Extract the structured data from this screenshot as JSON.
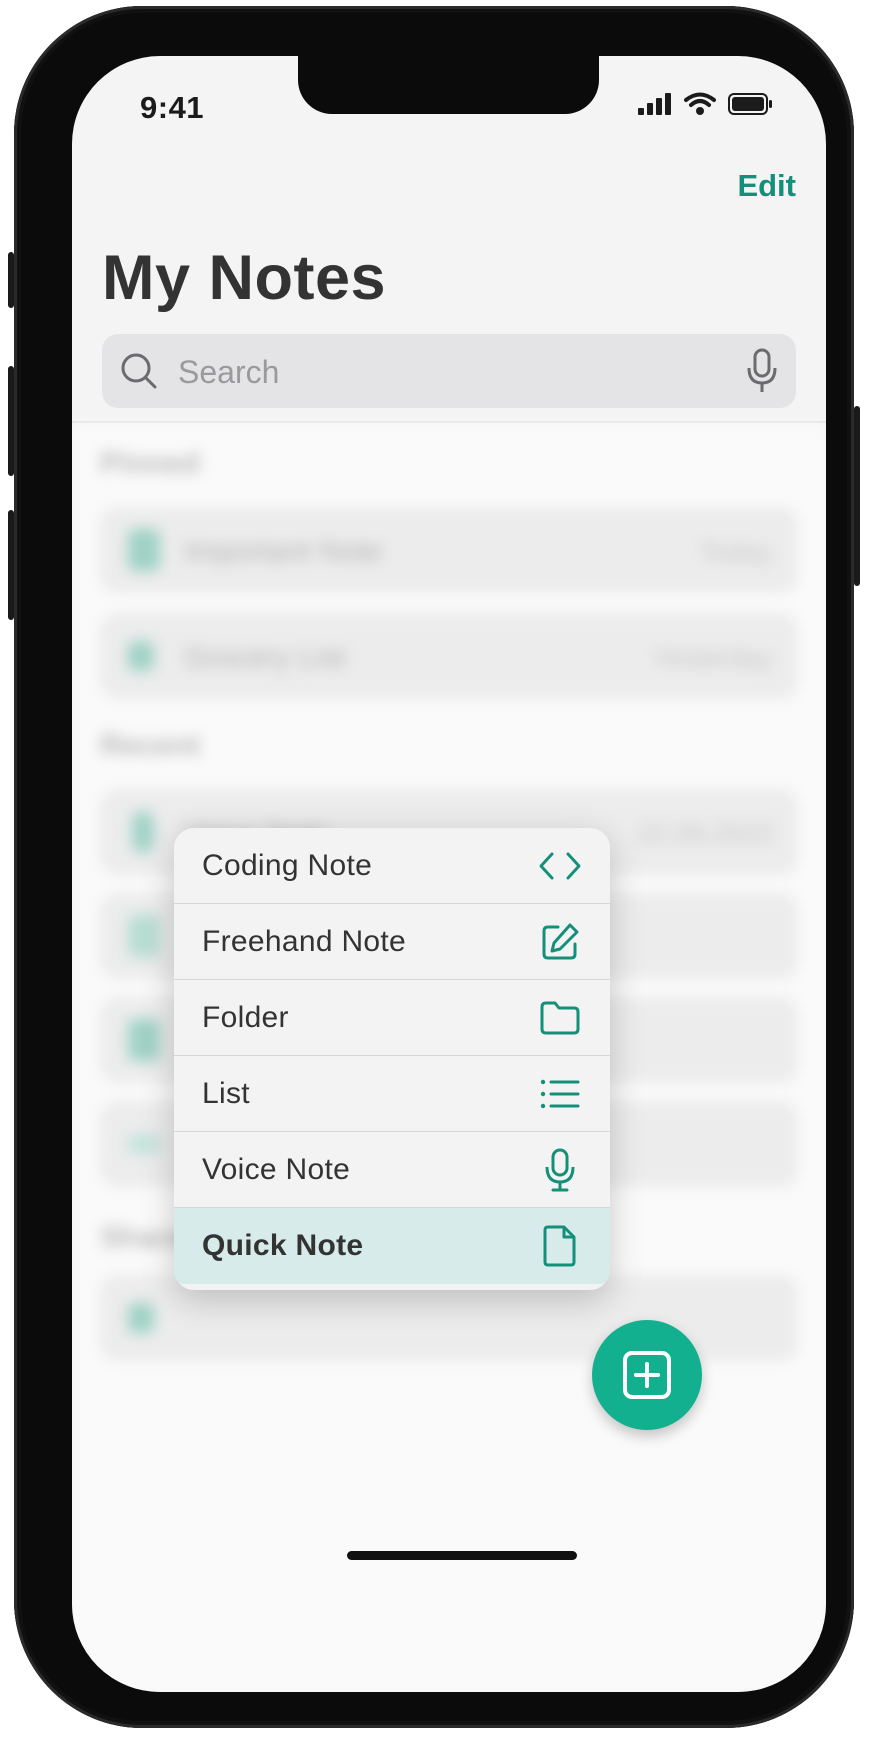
{
  "status_bar": {
    "time": "9:41"
  },
  "header": {
    "edit_label": "Edit",
    "title": "My Notes"
  },
  "search": {
    "placeholder": "Search"
  },
  "sections": {
    "pinned_label": "Pinned",
    "recent_label": "Recent",
    "shared_label": "Shared"
  },
  "notes": {
    "pinned": [
      {
        "title": "Important Note",
        "date": "Today"
      },
      {
        "title": "Grocery List",
        "date": "Yesterday"
      }
    ],
    "recent": [
      {
        "title": "Voice Note",
        "date": "22.09.2023"
      }
    ]
  },
  "menu": {
    "items": [
      {
        "label": "Coding Note",
        "icon": "code-icon"
      },
      {
        "label": "Freehand Note",
        "icon": "edit-icon"
      },
      {
        "label": "Folder",
        "icon": "folder-icon"
      },
      {
        "label": "List",
        "icon": "list-icon"
      },
      {
        "label": "Voice Note",
        "icon": "mic-icon"
      },
      {
        "label": "Quick Note",
        "icon": "file-icon",
        "highlighted": true
      }
    ]
  },
  "colors": {
    "accent": "#14907a",
    "fab": "#13b08f",
    "highlight": "#d7ecea"
  }
}
